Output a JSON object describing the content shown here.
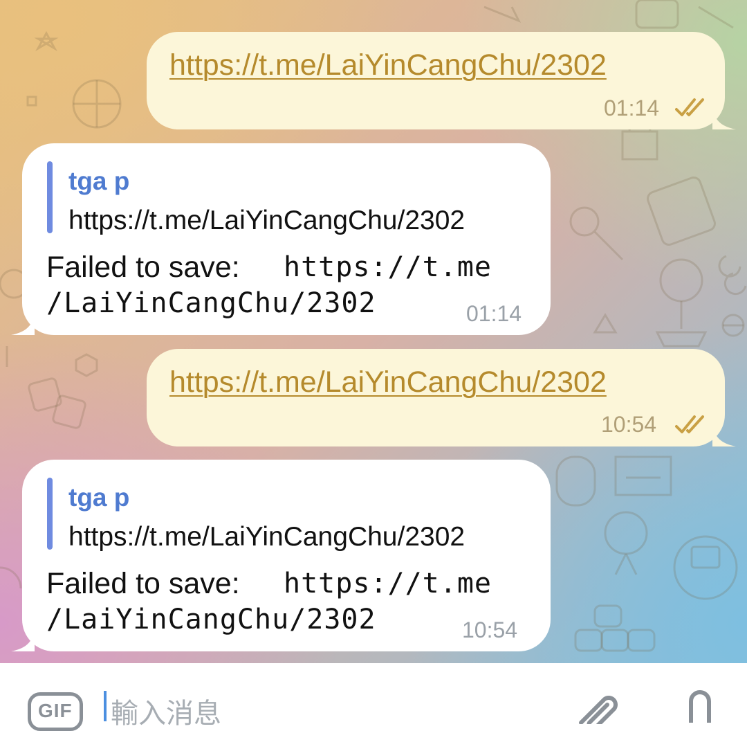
{
  "messages": [
    {
      "type": "outgoing",
      "link": "https://t.me/LaiYinCangChu/2302",
      "time": "01:14",
      "status": "read",
      "status_icon": "double-check-icon"
    },
    {
      "type": "incoming",
      "quote_author": "tga p",
      "quote_text": "https://t.me/LaiYinCangChu/2302",
      "text_prefix": "Failed to save: ",
      "text_code_1": "https://t.me",
      "text_code_2": "/LaiYinCangChu/2302",
      "time": "01:14"
    },
    {
      "type": "outgoing",
      "link": "https://t.me/LaiYinCangChu/2302",
      "time": "10:54",
      "status": "read",
      "status_icon": "double-check-icon"
    },
    {
      "type": "incoming",
      "quote_author": "tga p",
      "quote_text": "https://t.me/LaiYinCangChu/2302",
      "text_prefix": "Failed to save: ",
      "text_code_1": "https://t.me",
      "text_code_2": "/LaiYinCangChu/2302",
      "time": "10:54"
    }
  ],
  "input_bar": {
    "gif_label": "GIF",
    "placeholder": "輸入消息",
    "attach_icon": "paperclip-icon",
    "mic_icon": "microphone-icon"
  },
  "colors": {
    "outgoing_bubble": "#fcf6d9",
    "incoming_bubble": "#ffffff",
    "link": "#b58a2c",
    "quote_accent": "#6f8be0",
    "quote_name": "#4f7bd0",
    "read_ticks": "#c9a044"
  }
}
